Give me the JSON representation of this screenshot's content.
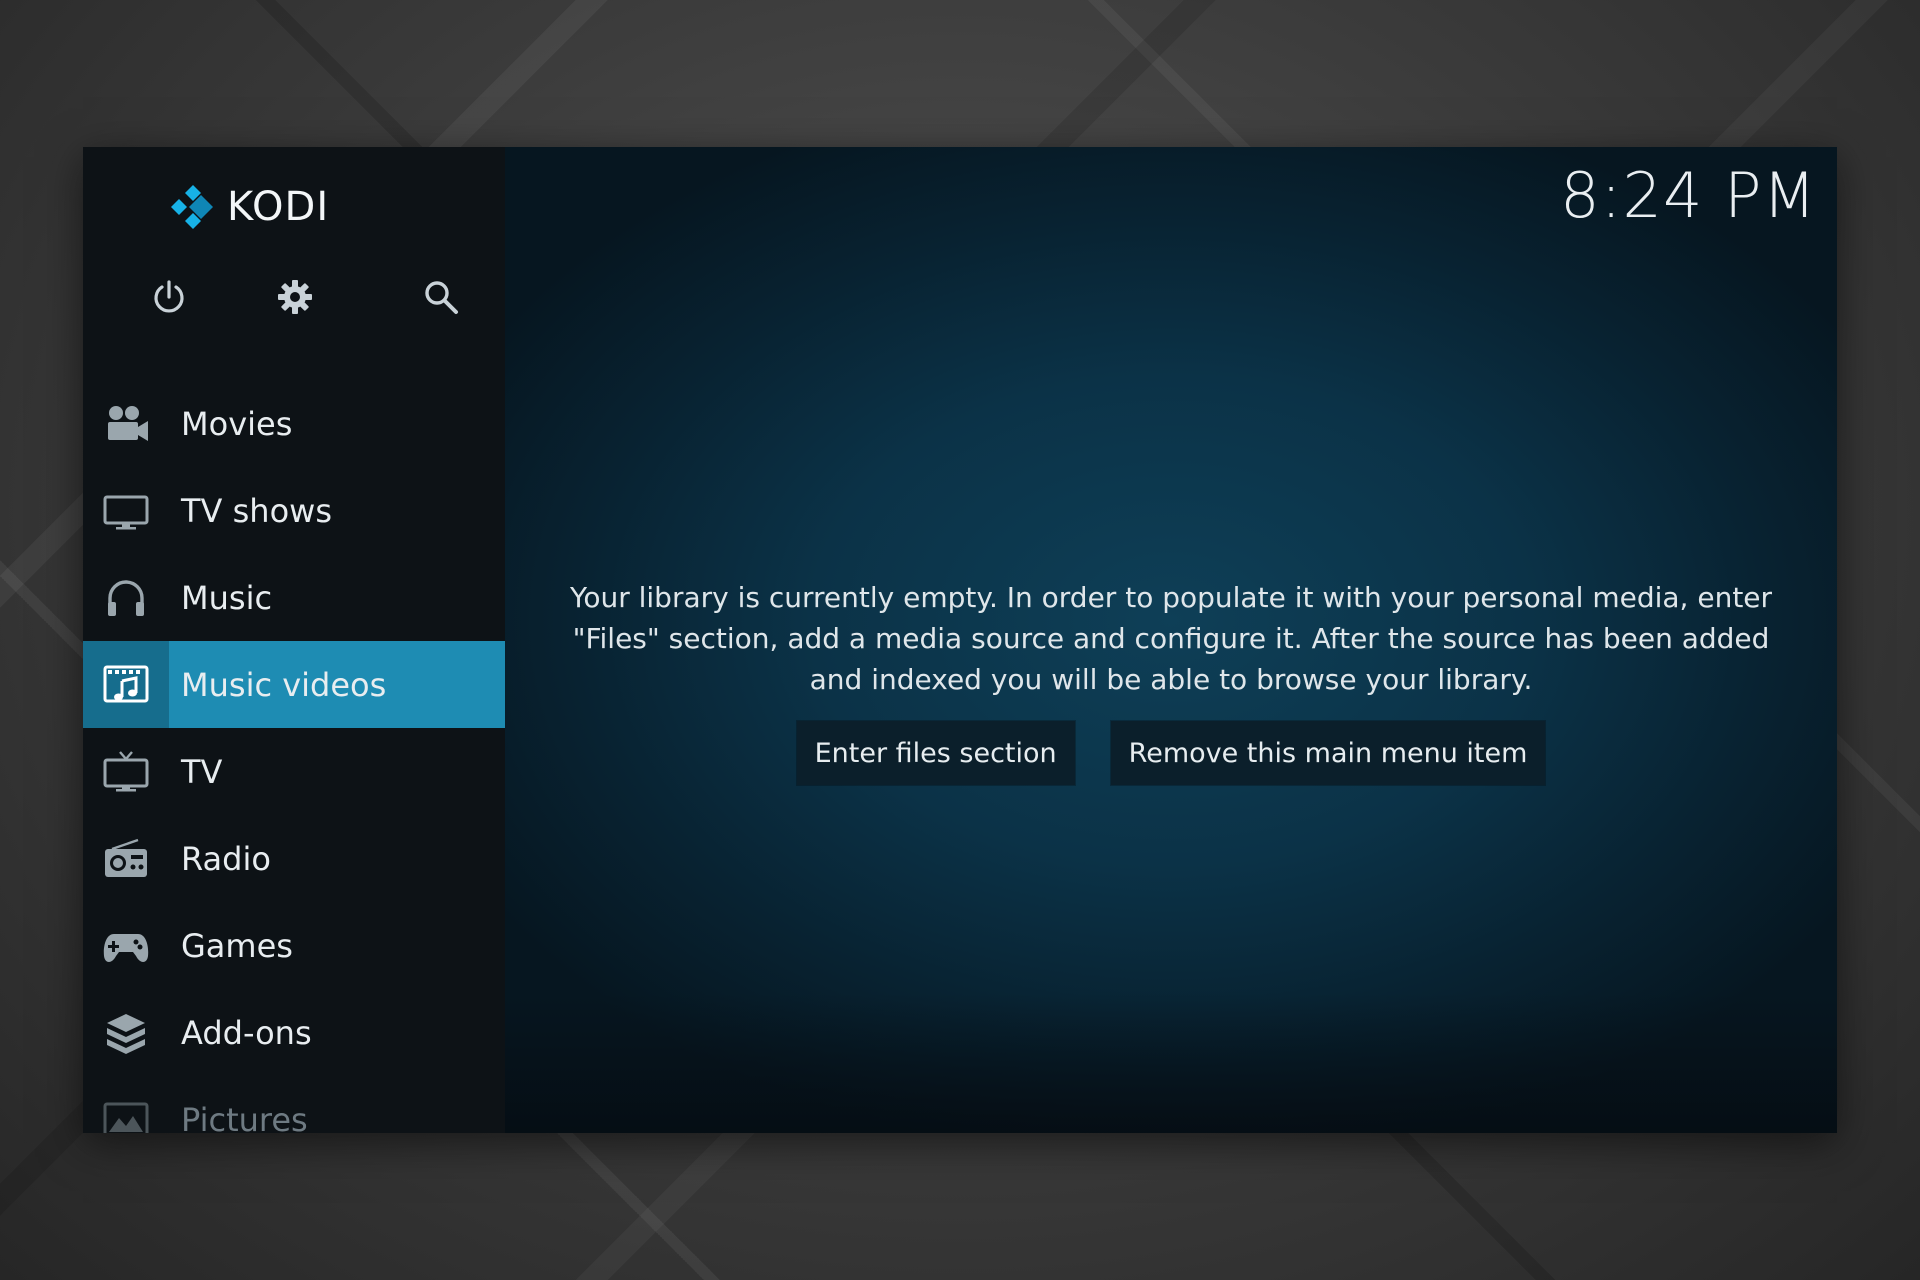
{
  "app": {
    "name": "KODI",
    "clock": "8:24 PM"
  },
  "top_icons": [
    {
      "name": "power-icon"
    },
    {
      "name": "gear-icon"
    },
    {
      "name": "search-icon"
    }
  ],
  "menu": {
    "items": [
      {
        "label": "Movies",
        "icon": "movies-icon"
      },
      {
        "label": "TV shows",
        "icon": "tv-shows-icon"
      },
      {
        "label": "Music",
        "icon": "headphones-icon"
      },
      {
        "label": "Music videos",
        "icon": "music-videos-icon",
        "active": true
      },
      {
        "label": "TV",
        "icon": "tv-icon"
      },
      {
        "label": "Radio",
        "icon": "radio-icon"
      },
      {
        "label": "Games",
        "icon": "gamepad-icon"
      },
      {
        "label": "Add-ons",
        "icon": "addons-icon"
      },
      {
        "label": "Pictures",
        "icon": "pictures-icon"
      }
    ]
  },
  "main": {
    "message": "Your library is currently empty. In order to populate it with your personal media, enter \"Files\" section, add a media source and configure it. After the source has been added and indexed you will be able to browse your library.",
    "buttons": {
      "enter_files": "Enter files section",
      "remove_item": "Remove this main menu item"
    }
  },
  "colors": {
    "accent": "#1e8cb3",
    "accent_dark": "#166d8d",
    "sidebar_bg": "#0d1216",
    "main_bg": "#0b3247"
  }
}
